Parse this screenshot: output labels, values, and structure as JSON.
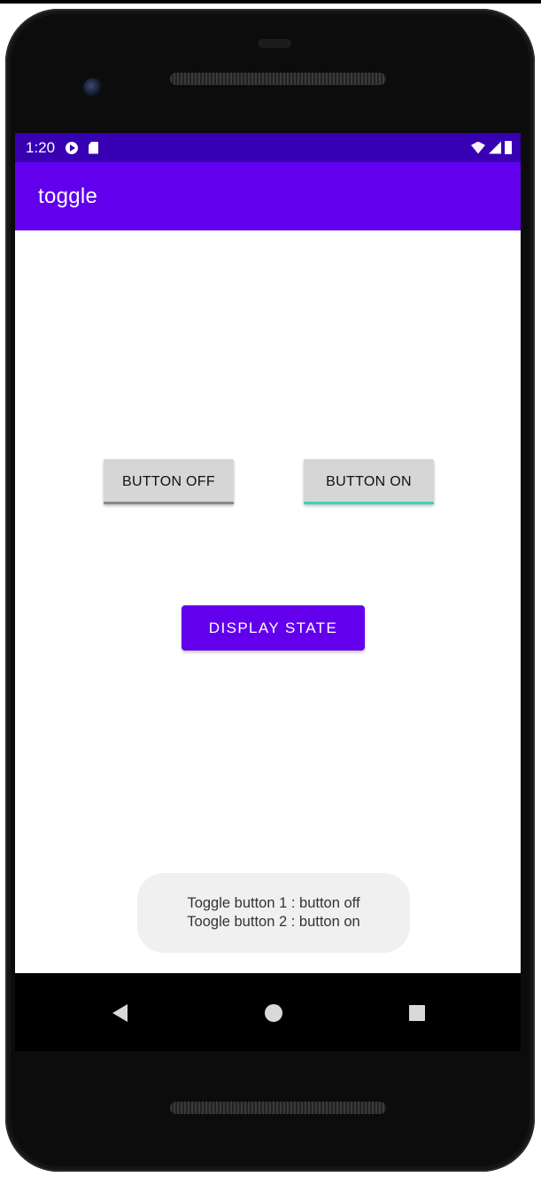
{
  "status_bar": {
    "time": "1:20",
    "icons": [
      "play-protect-icon",
      "sd-card-icon",
      "wifi-icon",
      "signal-icon",
      "battery-icon"
    ]
  },
  "app_bar": {
    "title": "toggle",
    "color": "#6200ee"
  },
  "toggles": [
    {
      "label": "BUTTON OFF",
      "checked": false,
      "indicator_color": "#8a8a8a"
    },
    {
      "label": "BUTTON ON",
      "checked": true,
      "indicator_color": "#3fd1c0"
    }
  ],
  "display_button": {
    "label": "DISPLAY STATE"
  },
  "toast": {
    "line1": "Toggle button 1 : button off",
    "line2": "Toogle button 2 : button on"
  },
  "nav": {
    "icons": [
      "back-icon",
      "home-icon",
      "recents-icon"
    ]
  }
}
